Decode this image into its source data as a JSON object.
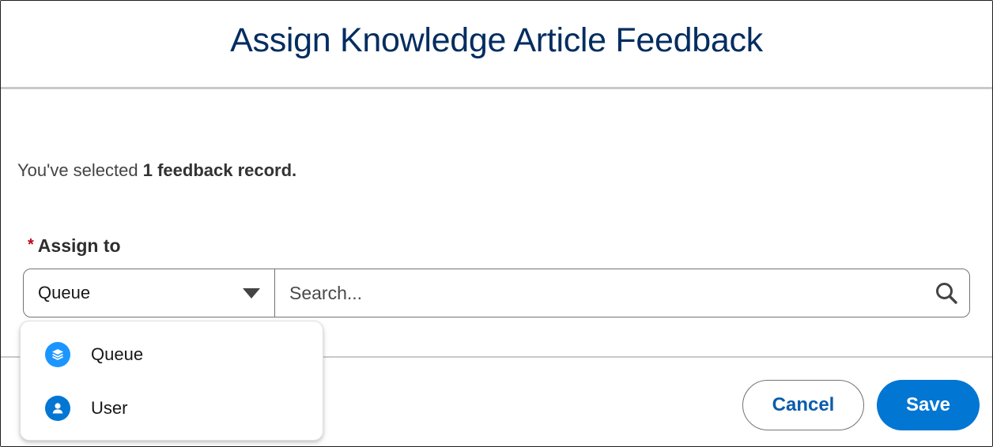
{
  "modal": {
    "title": "Assign Knowledge Article Feedback"
  },
  "selection": {
    "prefix": "You've selected ",
    "emphasis": "1 feedback record."
  },
  "assign_field": {
    "required_mark": "*",
    "label": "Assign to",
    "selected_type": "Queue",
    "search_placeholder": "Search..."
  },
  "dropdown": {
    "items": [
      {
        "label": "Queue",
        "icon": "queue-stack-icon",
        "icon_color": "#1b96ff"
      },
      {
        "label": "User",
        "icon": "user-icon",
        "icon_color": "#0176d3"
      }
    ]
  },
  "footer": {
    "cancel_label": "Cancel",
    "save_label": "Save"
  },
  "colors": {
    "title": "#032d60",
    "brand": "#0176d3",
    "link": "#0b5cab",
    "required": "#ba0517"
  }
}
